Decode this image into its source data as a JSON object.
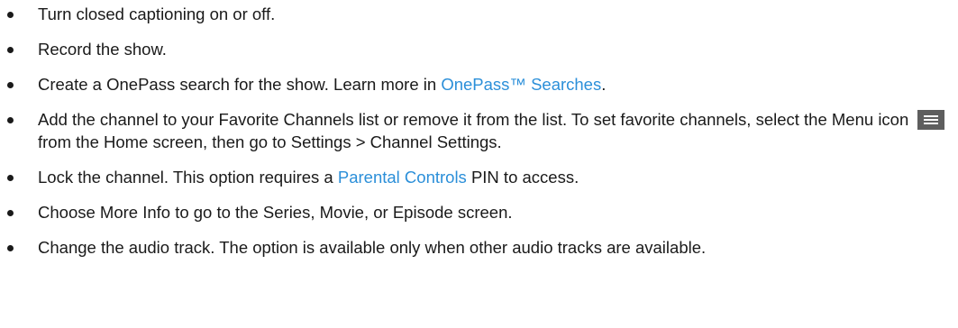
{
  "items": [
    {
      "text": "Turn closed captioning on or off."
    },
    {
      "text": "Record the show."
    },
    {
      "pre": "Create a OnePass search for the show. Learn more in ",
      "link": "OnePass™ Searches",
      "post": "."
    },
    {
      "pre": "Add the channel to your Favorite Channels list or remove it from the list. To set favorite channels, select the Menu icon",
      "icon": "menu-icon",
      "post": "from the Home screen, then go to Settings > Channel Settings."
    },
    {
      "pre": "Lock the channel. This option requires a ",
      "link": "Parental Controls",
      "post": " PIN to access."
    },
    {
      "text": "Choose More Info to go to the Series, Movie, or Episode screen."
    },
    {
      "text": "Change the audio track. The option is available only when other audio tracks are available."
    }
  ],
  "colors": {
    "text": "#1a1a1a",
    "link": "#2b8fd9",
    "icon_bg": "#5e5e5e"
  }
}
